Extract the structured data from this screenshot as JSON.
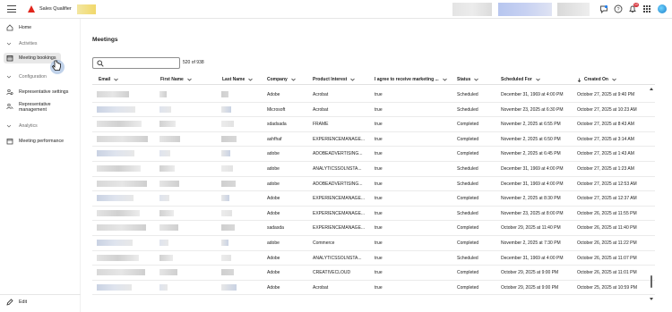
{
  "app": {
    "title": "Sales Qualifier"
  },
  "topbar": {
    "notification_count": "10"
  },
  "sidebar": {
    "home": "Home",
    "activities_section": "Activities",
    "meeting_bookings": "Meeting bookings",
    "configuration_section": "Configuration",
    "rep_settings": "Representative settings",
    "rep_management": "Representative management",
    "analytics_section": "Analytics",
    "meeting_performance": "Meeting performance",
    "edit": "Edit"
  },
  "page": {
    "title": "Meetings",
    "search_placeholder": "",
    "count": "520 of 938"
  },
  "table": {
    "columns": [
      "Email",
      "First Name",
      "Last Name",
      "Company",
      "Product Interest",
      "I agree to receive marketing ...",
      "Status",
      "Scheduled For",
      "Created On"
    ],
    "rows": [
      {
        "company": "Adobe",
        "product": "Acrobat",
        "agree": "true",
        "status": "Scheduled",
        "scheduled": "December 31, 1969 at 4:00 PM",
        "created": "October 27, 2025 at 9:40 PM"
      },
      {
        "company": "Microsoft",
        "product": "Acrobat",
        "agree": "true",
        "status": "Scheduled",
        "scheduled": "November 23, 2025 at 6:30 PM",
        "created": "October 27, 2025 at 10:23 AM"
      },
      {
        "company": "sdadsada",
        "product": "FRAME",
        "agree": "true",
        "status": "Completed",
        "scheduled": "November 2, 2025 at 6:55 PM",
        "created": "October 27, 2025 at 8:43 AM"
      },
      {
        "company": "ashfhaf",
        "product": "EXPERIENCEMANAGE...",
        "agree": "true",
        "status": "Completed",
        "scheduled": "November 2, 2025 at 6:50 PM",
        "created": "October 27, 2025 at 3:14 AM"
      },
      {
        "company": "adobe",
        "product": "ADOBEADVERTISING...",
        "agree": "true",
        "status": "Completed",
        "scheduled": "November 2, 2025 at 6:45 PM",
        "created": "October 27, 2025 at 1:43 AM"
      },
      {
        "company": "adobe",
        "product": "ANALYTICSSOLNSTA...",
        "agree": "true",
        "status": "Scheduled",
        "scheduled": "December 31, 1969 at 4:00 PM",
        "created": "October 27, 2025 at 1:23 AM"
      },
      {
        "company": "adobe",
        "product": "ADOBEADVERTISING...",
        "agree": "true",
        "status": "Scheduled",
        "scheduled": "December 31, 1969 at 4:00 PM",
        "created": "October 27, 2025 at 12:53 AM"
      },
      {
        "company": "Adobe",
        "product": "EXPERIENCEMANAGE...",
        "agree": "true",
        "status": "Completed",
        "scheduled": "November 2, 2025 at 8:30 PM",
        "created": "October 27, 2025 at 12:37 AM"
      },
      {
        "company": "Adobe",
        "product": "EXPERIENCEMANAGE...",
        "agree": "true",
        "status": "Scheduled",
        "scheduled": "November 23, 2025 at 8:00 PM",
        "created": "October 26, 2025 at 11:55 PM"
      },
      {
        "company": "sadasda",
        "product": "EXPERIENCEMANAGE...",
        "agree": "true",
        "status": "Completed",
        "scheduled": "October 29, 2025 at 11:40 PM",
        "created": "October 26, 2025 at 11:40 PM"
      },
      {
        "company": "adobe",
        "product": "Commerce",
        "agree": "true",
        "status": "Completed",
        "scheduled": "November 2, 2025 at 7:30 PM",
        "created": "October 26, 2025 at 11:22 PM"
      },
      {
        "company": "Adobe",
        "product": "ANALYTICSSOLNSTA...",
        "agree": "true",
        "status": "Scheduled",
        "scheduled": "December 31, 1969 at 4:00 PM",
        "created": "October 26, 2025 at 11:07 PM"
      },
      {
        "company": "Adobe",
        "product": "CREATIVECLOUD",
        "agree": "true",
        "status": "Completed",
        "scheduled": "October 29, 2025 at 9:00 PM",
        "created": "October 26, 2025 at 11:01 PM"
      },
      {
        "company": "Adobe",
        "product": "Acrobat",
        "agree": "true",
        "status": "Completed",
        "scheduled": "October 29, 2025 at 9:00 PM",
        "created": "October 25, 2025 at 10:59 PM"
      }
    ]
  },
  "colors": {
    "accent": "#e1251b",
    "badge": "#d7373f",
    "active_nav": "#e8e8e8"
  }
}
